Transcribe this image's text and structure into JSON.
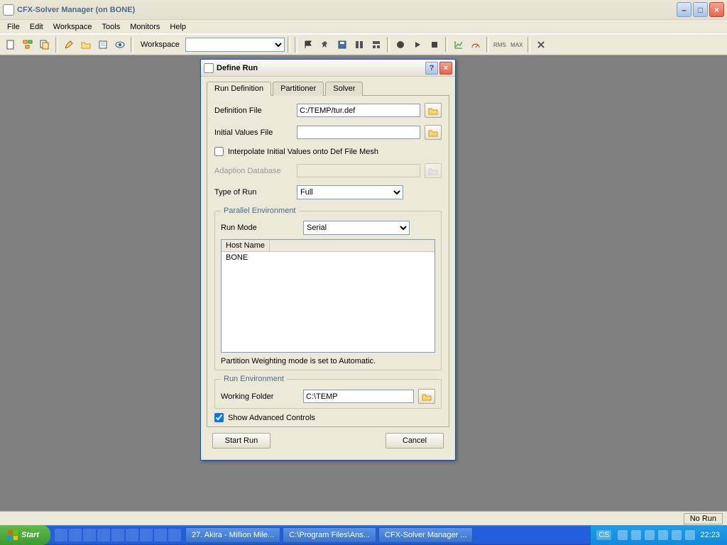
{
  "window": {
    "title": "CFX-Solver Manager (on BONE)"
  },
  "menu": [
    "File",
    "Edit",
    "Workspace",
    "Tools",
    "Monitors",
    "Help"
  ],
  "toolbar": {
    "workspace_label": "Workspace"
  },
  "status": {
    "right": "No Run"
  },
  "dialog": {
    "title": "Define Run",
    "tabs": [
      "Run Definition",
      "Partitioner",
      "Solver"
    ],
    "labels": {
      "definition_file": "Definition File",
      "initial_values_file": "Initial Values File",
      "interpolate": "Interpolate Initial Values onto Def File Mesh",
      "adaption_db": "Adaption Database",
      "type_of_run": "Type of Run",
      "parallel_env": "Parallel Environment",
      "run_mode": "Run Mode",
      "host_name": "Host Name",
      "partition_note": "Partition Weighting mode is set to Automatic.",
      "run_env": "Run Environment",
      "working_folder": "Working Folder",
      "show_advanced": "Show Advanced Controls"
    },
    "values": {
      "definition_file": "C:/TEMP/tur.def",
      "initial_values_file": "",
      "adaption_db": "",
      "type_of_run": "Full",
      "run_mode": "Serial",
      "host": "BONE",
      "working_folder": "C:\\TEMP",
      "show_advanced_checked": true,
      "interpolate_checked": false
    },
    "buttons": {
      "start": "Start Run",
      "cancel": "Cancel"
    }
  },
  "taskbar": {
    "start": "Start",
    "tasks": [
      "27. Akira - Million Mile...",
      "C:\\Program Files\\Ans...",
      "CFX-Solver Manager ..."
    ],
    "lang": "CS",
    "clock": "22:23"
  }
}
